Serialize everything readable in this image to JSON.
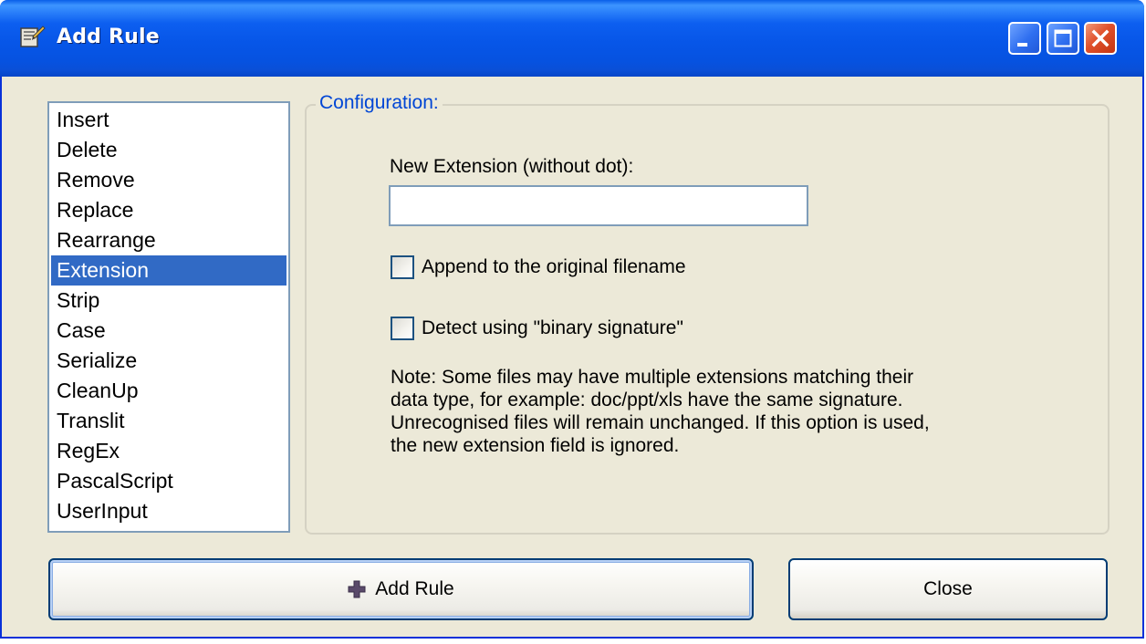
{
  "window": {
    "title": "Add Rule"
  },
  "rules_list": {
    "items": [
      "Insert",
      "Delete",
      "Remove",
      "Replace",
      "Rearrange",
      "Extension",
      "Strip",
      "Case",
      "Serialize",
      "CleanUp",
      "Translit",
      "RegEx",
      "PascalScript",
      "UserInput"
    ],
    "selected": "Extension"
  },
  "config": {
    "legend": "Configuration:",
    "new_extension_label": "New Extension (without dot):",
    "new_extension_value": "",
    "append_label": "Append to the original filename",
    "append_checked": false,
    "detect_label": "Detect using \"binary signature\"",
    "detect_checked": false,
    "note_lines": [
      "Note: Some files may have multiple extensions matching their",
      "data type, for example: doc/ppt/xls have the same signature.",
      "Unrecognised files will remain unchanged. If this option is used,",
      "the new extension field is ignored."
    ]
  },
  "buttons": {
    "add_rule_label": "Add Rule",
    "close_label": "Close"
  },
  "colors": {
    "titlebar": "#0756e8",
    "selection": "#316ac5",
    "legend_text": "#0046d5",
    "window_bg": "#ece9d8"
  },
  "icons": {
    "app": "app-icon",
    "minimize": "minimize-icon",
    "maximize": "maximize-icon",
    "close": "close-icon",
    "add": "plus-icon"
  }
}
